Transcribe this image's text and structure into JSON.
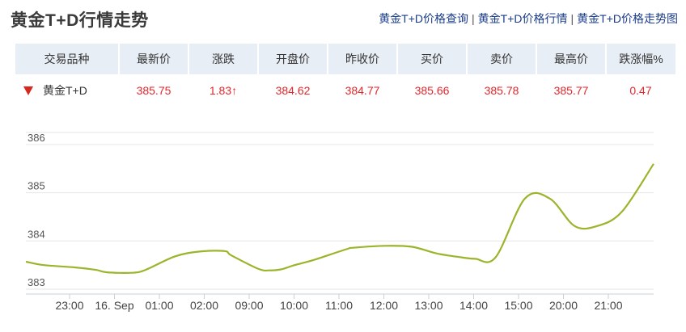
{
  "header": {
    "title": "黄金T+D行情走势",
    "links": [
      {
        "label": "黄金T+D价格查询"
      },
      {
        "label": "黄金T+D价格行情"
      },
      {
        "label": "黄金T+D价格走势图"
      }
    ],
    "separator": "|"
  },
  "table": {
    "headers": [
      "交易品种",
      "最新价",
      "涨跌",
      "开盘价",
      "昨收价",
      "买价",
      "卖价",
      "最高价",
      "跌涨幅%"
    ],
    "row": {
      "name": "黄金T+D",
      "latest": "385.75",
      "change": "1.83↑",
      "open": "384.62",
      "prev_close": "384.77",
      "bid": "385.66",
      "ask": "385.78",
      "high": "385.77",
      "change_pct": "0.47"
    }
  },
  "colors": {
    "price_up": "#e4262b",
    "header_bg": "#e8eef5",
    "line": "#9ab52a",
    "link": "#1a3c8c"
  },
  "chart_data": {
    "type": "line",
    "categories": [
      "23:00",
      "16. Sep",
      "01:00",
      "02:00",
      "09:00",
      "10:00",
      "11:00",
      "12:00",
      "13:00",
      "14:00",
      "15:00",
      "20:00",
      "21:00"
    ],
    "x": [
      0,
      0.8,
      2.2,
      3.1,
      3.6,
      4.7,
      5.3,
      6.6,
      7.7,
      8.8,
      9.1,
      10.3,
      10.8,
      11.3,
      11.9,
      12.7,
      14.2,
      14.5,
      15.9,
      17.1,
      18.2,
      19.3,
      19.9,
      20.8,
      22.1,
      23.2,
      24.3,
      25.3,
      26.4,
      27.8
    ],
    "series": [
      {
        "values": [
          383.57,
          383.5,
          383.45,
          383.4,
          383.35,
          383.34,
          383.4,
          383.68,
          383.78,
          383.79,
          383.7,
          383.42,
          383.39,
          383.41,
          383.5,
          383.6,
          383.83,
          383.86,
          383.9,
          383.88,
          383.74,
          383.66,
          383.63,
          383.66,
          384.88,
          384.88,
          384.31,
          384.31,
          384.61,
          385.6
        ]
      }
    ],
    "ylim": [
      383,
      386.25
    ],
    "yticks": [
      383,
      384,
      385,
      386
    ],
    "xlim": [
      0,
      27.8
    ],
    "grid": true
  }
}
